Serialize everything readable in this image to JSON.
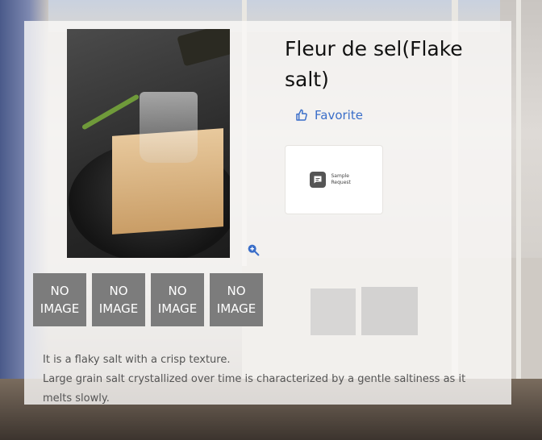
{
  "product": {
    "title": "Fleur de sel(Flake salt)"
  },
  "actions": {
    "favorite_label": "Favorite",
    "favorite_icon": "thumbs-up-icon",
    "sample_request_label": "Sample Request",
    "sample_request_icon": "chat-bubble-icon",
    "zoom_icon": "zoom-in-icon"
  },
  "thumbnails": [
    {
      "line1": "NO",
      "line2": "IMAGE"
    },
    {
      "line1": "NO",
      "line2": "IMAGE"
    },
    {
      "line1": "NO",
      "line2": "IMAGE"
    },
    {
      "line1": "NO",
      "line2": "IMAGE"
    }
  ],
  "description": {
    "line1": "It is a flaky salt with a crisp texture.",
    "line2": "Large grain salt crystallized over time is characterized by a gentle saltiness as it melts slowly."
  },
  "colors": {
    "accent": "#3a6ec9",
    "thumbnail_bg": "#7c7c7c",
    "panel_bg": "#faf9f7"
  }
}
